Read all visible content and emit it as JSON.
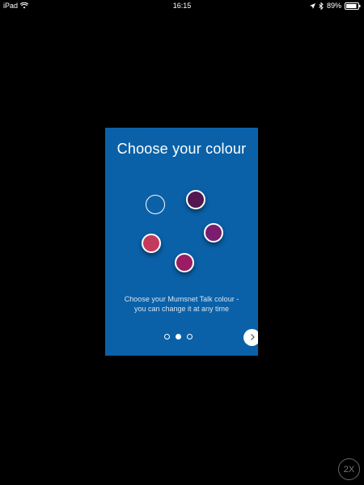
{
  "status_bar": {
    "device": "iPad",
    "time": "16:15",
    "battery_percent": "89%",
    "battery_level": 0.89,
    "icons": [
      "wifi-icon",
      "location-icon",
      "bluetooth-icon",
      "battery-icon"
    ]
  },
  "card": {
    "title": "Choose your colour",
    "subtitle_line1": "Choose your Mumsnet Talk colour -",
    "subtitle_line2": "you can change it at any time",
    "background": "#0a61a8",
    "swatches": [
      {
        "name": "blue",
        "color": "#0a61a8",
        "selected": true
      },
      {
        "name": "dark-purple",
        "color": "#52174e",
        "selected": false
      },
      {
        "name": "purple",
        "color": "#7b1d6e",
        "selected": false
      },
      {
        "name": "magenta",
        "color": "#9b1c62",
        "selected": false
      },
      {
        "name": "raspberry",
        "color": "#c43a5c",
        "selected": false
      }
    ],
    "pager": {
      "count": 3,
      "active": 2
    },
    "next_icon": "chevron-right-icon"
  },
  "zoom_button": {
    "label": "2X"
  }
}
